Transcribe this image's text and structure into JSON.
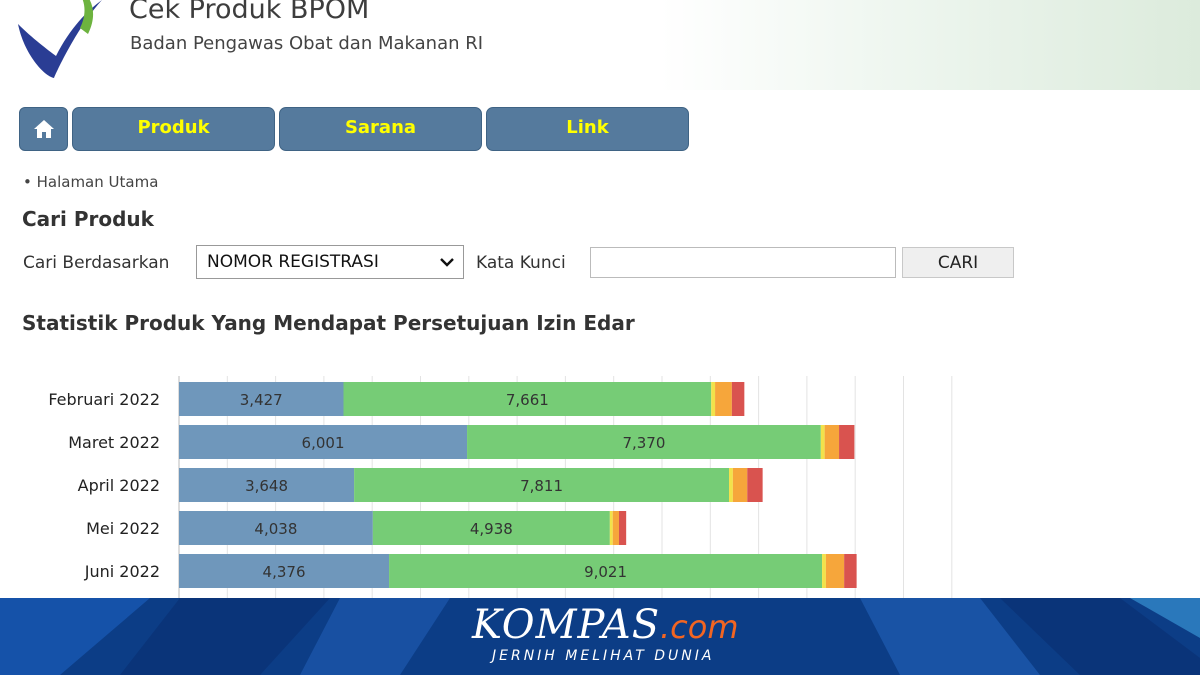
{
  "header": {
    "title": "Cek Produk BPOM",
    "subtitle": "Badan Pengawas Obat dan Makanan RI",
    "logo_icon": "bpom-check-logo-icon"
  },
  "nav": {
    "home_icon": "home-icon",
    "tabs": [
      {
        "label": "Produk"
      },
      {
        "label": "Sarana"
      },
      {
        "label": "Link"
      }
    ],
    "tab_text_color": "#ffff00",
    "tab_bg_color": "#557a9d"
  },
  "breadcrumb": "• Halaman Utama",
  "search": {
    "title": "Cari Produk",
    "by_label": "Cari Berdasarkan",
    "by_selected": "NOMOR REGISTRASI",
    "keyword_label": "Kata Kunci",
    "keyword_value": "",
    "button_label": "CARI"
  },
  "stats_title": "Statistik Produk Yang Mendapat Persetujuan Izin Edar",
  "chart_data": {
    "type": "bar",
    "orientation": "horizontal",
    "stacked": true,
    "title": "",
    "categories": [
      "Februari 2022",
      "Maret 2022",
      "April 2022",
      "Mei 2022",
      "Juni 2022"
    ],
    "series": [
      {
        "color": "#6f97bb",
        "values": [
          3427,
          6001,
          3648,
          4038,
          4376
        ]
      },
      {
        "color": "#76cc76",
        "values": [
          7661,
          7370,
          7811,
          4938,
          9021
        ]
      },
      {
        "color": "#f2e24a",
        "values": [
          80,
          80,
          80,
          60,
          80
        ]
      },
      {
        "color": "#f6a63b",
        "values": [
          350,
          300,
          300,
          130,
          380
        ]
      },
      {
        "color": "#d9534f",
        "values": [
          260,
          320,
          320,
          150,
          260
        ]
      }
    ],
    "data_labels": [
      [
        "3,427",
        "7,661"
      ],
      [
        "6,001",
        "7,370"
      ],
      [
        "3,648",
        "7,811"
      ],
      [
        "4,038",
        "4,938"
      ],
      [
        "4,376",
        "9,021"
      ]
    ],
    "grid": true,
    "legend": "none"
  },
  "footer": {
    "brand": "KOMPAS",
    "brand_suffix": ".com",
    "tagline": "JERNIH MELIHAT DUNIA",
    "bg_color": "#0c3d86",
    "accent_color": "#f26522"
  }
}
